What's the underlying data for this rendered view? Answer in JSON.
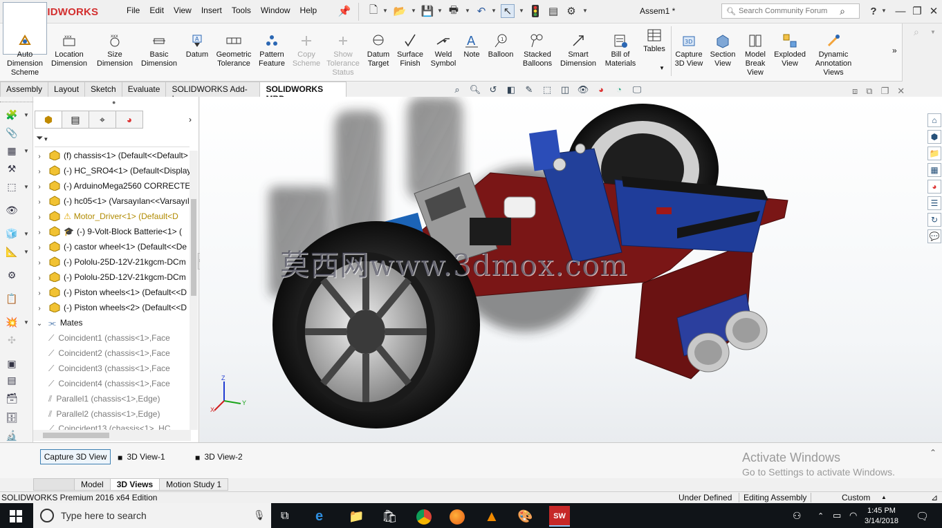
{
  "app": {
    "brand": "SOLIDWORKS",
    "document": "Assem1 *",
    "menus": [
      "File",
      "Edit",
      "View",
      "Insert",
      "Tools",
      "Window",
      "Help"
    ],
    "search_placeholder": "Search Community Forum",
    "help": "?"
  },
  "commands": [
    {
      "label1": "Auto",
      "label2": "Dimension",
      "label3": "Scheme",
      "icon": "auto-dimension-icon",
      "enabled": true
    },
    {
      "label1": "Location",
      "label2": "Dimension",
      "label3": "",
      "icon": "location-dimension-icon",
      "enabled": true
    },
    {
      "label1": "Size",
      "label2": "Dimension",
      "label3": "",
      "icon": "size-dimension-icon",
      "enabled": true
    },
    {
      "label1": "Basic",
      "label2": "Dimension",
      "label3": "",
      "icon": "basic-dimension-icon",
      "enabled": true
    },
    {
      "label1": "Datum",
      "label2": "",
      "label3": "",
      "icon": "datum-icon",
      "enabled": true
    },
    {
      "label1": "Geometric",
      "label2": "Tolerance",
      "label3": "",
      "icon": "geometric-tolerance-icon",
      "enabled": true
    },
    {
      "label1": "Pattern",
      "label2": "Feature",
      "label3": "",
      "icon": "pattern-feature-icon",
      "enabled": true
    },
    {
      "label1": "Copy",
      "label2": "Scheme",
      "label3": "",
      "icon": "copy-scheme-icon",
      "enabled": false
    },
    {
      "label1": "Show",
      "label2": "Tolerance",
      "label3": "Status",
      "icon": "show-tolerance-status-icon",
      "enabled": false
    },
    {
      "label1": "Datum",
      "label2": "Target",
      "label3": "",
      "icon": "datum-target-icon",
      "enabled": true
    },
    {
      "label1": "Surface",
      "label2": "Finish",
      "label3": "",
      "icon": "surface-finish-icon",
      "enabled": true
    },
    {
      "label1": "Weld",
      "label2": "Symbol",
      "label3": "",
      "icon": "weld-symbol-icon",
      "enabled": true
    },
    {
      "label1": "Note",
      "label2": "",
      "label3": "",
      "icon": "note-icon",
      "enabled": true
    },
    {
      "label1": "Balloon",
      "label2": "",
      "label3": "",
      "icon": "balloon-icon",
      "enabled": true
    },
    {
      "label1": "Stacked",
      "label2": "Balloons",
      "label3": "",
      "icon": "stacked-balloons-icon",
      "enabled": true
    },
    {
      "label1": "Smart",
      "label2": "Dimension",
      "label3": "",
      "icon": "smart-dimension-icon",
      "enabled": true
    },
    {
      "label1": "Bill of",
      "label2": "Materials",
      "label3": "",
      "icon": "bill-of-materials-icon",
      "enabled": true
    },
    {
      "label1": "Tables",
      "label2": "",
      "label3": "",
      "icon": "tables-icon",
      "enabled": true
    },
    {
      "label1": "Capture",
      "label2": "3D View",
      "label3": "",
      "icon": "capture-3d-view-icon",
      "enabled": true
    },
    {
      "label1": "Section",
      "label2": "View",
      "label3": "",
      "icon": "section-view-icon",
      "enabled": true
    },
    {
      "label1": "Model",
      "label2": "Break",
      "label3": "View",
      "icon": "model-break-view-icon",
      "enabled": true
    },
    {
      "label1": "Exploded",
      "label2": "View",
      "label3": "",
      "icon": "exploded-view-icon",
      "enabled": true
    },
    {
      "label1": "Dynamic",
      "label2": "Annotation",
      "label3": "Views",
      "icon": "dynamic-annotation-views-icon",
      "enabled": true
    }
  ],
  "tabs": [
    "Assembly",
    "Layout",
    "Sketch",
    "Evaluate",
    "SOLIDWORKS Add-Ins",
    "SOLIDWORKS MBD"
  ],
  "active_tab": "SOLIDWORKS MBD",
  "tree": [
    {
      "text": "(f) chassis<1> (Default<<Default>",
      "kind": "part"
    },
    {
      "text": "(-) HC_SRO4<1> (Default<Display",
      "kind": "part"
    },
    {
      "text": "(-) ArduinoMega2560 CORRECTED",
      "kind": "part"
    },
    {
      "text": "(-) hc05<1> (Varsayılan<<Varsayıl",
      "kind": "part"
    },
    {
      "text": "Motor_Driver<1> (Default<D",
      "kind": "warn"
    },
    {
      "text": "(-) 9-Volt-Block Batterie<1> (",
      "kind": "part"
    },
    {
      "text": "(-) castor wheel<1> (Default<<De",
      "kind": "part"
    },
    {
      "text": "(-) Pololu-25D-12V-21kgcm-DCm",
      "kind": "part"
    },
    {
      "text": "(-) Pololu-25D-12V-21kgcm-DCm",
      "kind": "part"
    },
    {
      "text": "(-) Piston wheels<1> (Default<<D",
      "kind": "part"
    },
    {
      "text": "(-) Piston wheels<2> (Default<<D",
      "kind": "part"
    },
    {
      "text": "Mates",
      "kind": "mates"
    },
    {
      "text": "Coincident1 (chassis<1>,Face",
      "kind": "mate"
    },
    {
      "text": "Coincident2 (chassis<1>,Face",
      "kind": "mate"
    },
    {
      "text": "Coincident3 (chassis<1>,Face",
      "kind": "mate"
    },
    {
      "text": "Coincident4 (chassis<1>,Face",
      "kind": "mate"
    },
    {
      "text": "Parallel1 (chassis<1>,Edge)",
      "kind": "mate"
    },
    {
      "text": "Parallel2 (chassis<1>,Edge)",
      "kind": "mate"
    },
    {
      "text": "Coincident13 (chassis<1>, HC",
      "kind": "mate"
    }
  ],
  "watermark": "莫西网www.3dmox.com",
  "triad": {
    "z": "Z",
    "y": "Y",
    "x": "X"
  },
  "bottom_panel": {
    "capture_button": "Capture 3D View",
    "views": [
      "3D View-1",
      "3D View-2"
    ]
  },
  "activate": {
    "line1": "Activate Windows",
    "line2": "Go to Settings to activate Windows."
  },
  "bottom_tabs": [
    "Model",
    "3D Views",
    "Motion Study 1"
  ],
  "active_bottom_tab": "3D Views",
  "status": {
    "edition": "SOLIDWORKS Premium 2016 x64 Edition",
    "state": "Under Defined",
    "mode": "Editing Assembly",
    "units": "Custom"
  },
  "taskbar": {
    "search_placeholder": "Type here to search",
    "time": "1:45 PM",
    "date": "3/14/2018"
  },
  "colors": {
    "brand_red": "#d32f2f",
    "chassis": "#7a1616",
    "board_blue": "#1f3d9a",
    "taskbar": "#101418"
  }
}
